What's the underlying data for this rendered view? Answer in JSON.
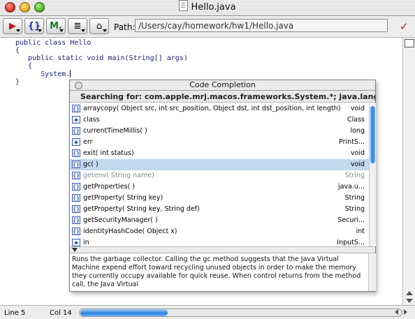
{
  "window": {
    "title": "Hello.java"
  },
  "toolbar": {
    "path_label": "Path:",
    "path_value": "/Users/cay/homework/hw1/Hello.java",
    "buttons": [
      {
        "icon": "debug-icon",
        "glyph": "▶"
      },
      {
        "icon": "braces-icon",
        "glyph": "{}"
      },
      {
        "icon": "methods-icon",
        "glyph": "M."
      },
      {
        "icon": "document-icon",
        "glyph": "≣"
      },
      {
        "icon": "lock-icon",
        "glyph": "⌂"
      }
    ]
  },
  "editor": {
    "lines": [
      "public class Hello",
      "{",
      "   public static void main(String[] args)",
      "   {",
      "      System."
    ],
    "closing": "}"
  },
  "status": {
    "line": "Line 5",
    "col": "Col 14"
  },
  "completion": {
    "title": "Code Completion",
    "search": "Searching for: com.apple.mrj.macos.frameworks.System.*; java.lang.System",
    "items": [
      {
        "kind": "method",
        "sig": "arraycopy( Object src, int src_position, Object dst, int dst_position, int length)",
        "type": "void"
      },
      {
        "kind": "field",
        "sig": "class",
        "type": "Class"
      },
      {
        "kind": "method",
        "sig": "currentTimeMillis( )",
        "type": "long"
      },
      {
        "kind": "field",
        "sig": "err",
        "type": "PrintS..."
      },
      {
        "kind": "method",
        "sig": "exit( int status)",
        "type": "void"
      },
      {
        "kind": "method",
        "sig": "gc( )",
        "type": "void",
        "selected": true
      },
      {
        "kind": "method",
        "sig": "getenv( String name)",
        "type": "String",
        "dim": true
      },
      {
        "kind": "method",
        "sig": "getProperties( )",
        "type": "java.u..."
      },
      {
        "kind": "method",
        "sig": "getProperty( String key)",
        "type": "String"
      },
      {
        "kind": "method",
        "sig": "getProperty( String key, String def)",
        "type": "String"
      },
      {
        "kind": "method",
        "sig": "getSecurityManager( )",
        "type": "Securi..."
      },
      {
        "kind": "method",
        "sig": "identityHashCode( Object x)",
        "type": "int"
      },
      {
        "kind": "field",
        "sig": "in",
        "type": "InputS..."
      }
    ],
    "description": "Runs the garbage collector. Calling the gc method suggests that the Java Virtual Machine expend effort toward recycling unused objects in order to make the memory they currently occupy available for quick reuse. When control returns from the method call, the Java Virtual"
  }
}
